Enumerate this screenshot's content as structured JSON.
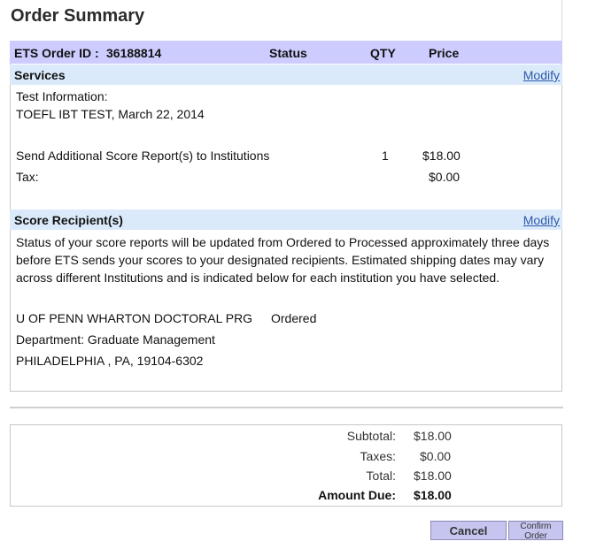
{
  "page": {
    "title": "Order Summary"
  },
  "header": {
    "order_id_label": "ETS Order ID :",
    "order_id": "36188814",
    "status": "Status",
    "qty": "QTY",
    "price": "Price"
  },
  "services": {
    "label": "Services",
    "modify": "Modify",
    "test_info_label": "Test Information:",
    "test_name": "TOEFL IBT TEST, March 22, 2014",
    "line_item": {
      "description": "Send Additional Score Report(s) to Institutions",
      "qty": "1",
      "price": "$18.00"
    },
    "tax": {
      "label": "Tax:",
      "price": "$0.00"
    }
  },
  "recipients": {
    "label": "Score Recipient(s)",
    "modify": "Modify",
    "note": "Status of your score reports will be updated from Ordered to Processed approximately three days before ETS sends your scores to your designated recipients. Estimated shipping dates may vary across different Institutions and is indicated below for each institution you have selected.",
    "institution": "U OF PENN WHARTON DOCTORAL PRG",
    "status": "Ordered",
    "department": "Department: Graduate Management",
    "address": "PHILADELPHIA , PA, 19104-6302"
  },
  "totals": {
    "subtotal_label": "Subtotal:",
    "subtotal": "$18.00",
    "taxes_label": "Taxes:",
    "taxes": "$0.00",
    "total_label": "Total:",
    "total": "$18.00",
    "amount_due_label": "Amount Due:",
    "amount_due": "$18.00"
  },
  "buttons": {
    "cancel": "Cancel",
    "confirm": "Confirm Order"
  }
}
